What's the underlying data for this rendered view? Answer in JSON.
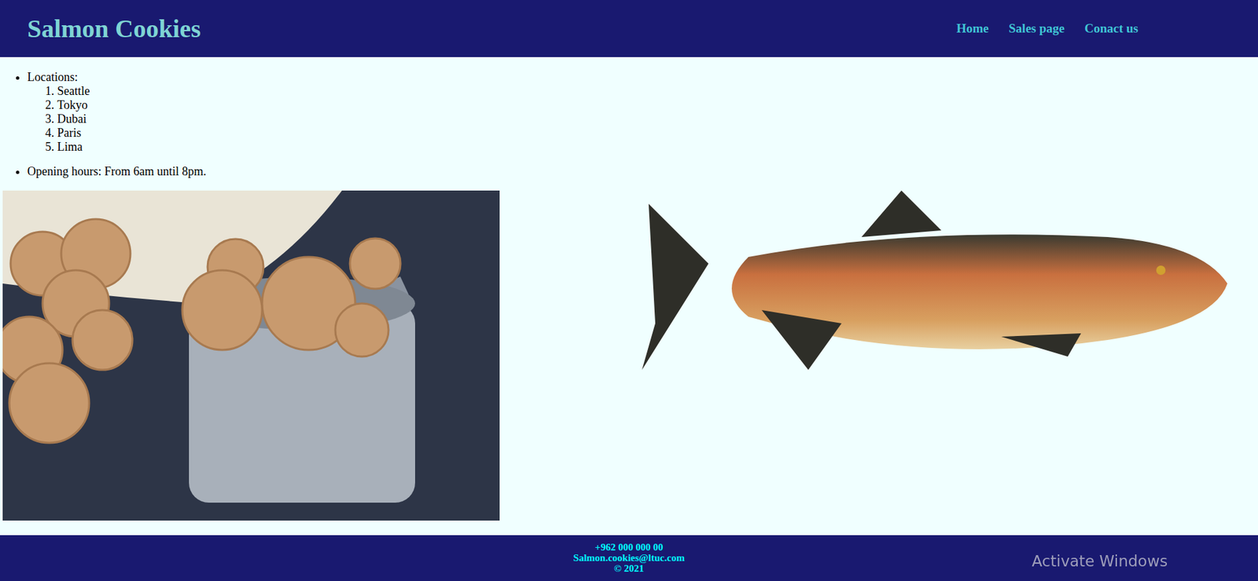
{
  "header": {
    "title": "Salmon Cookies",
    "nav": [
      {
        "label": "Home"
      },
      {
        "label": "Sales page"
      },
      {
        "label": "Conact us"
      }
    ]
  },
  "info": {
    "locations_label": "Locations:",
    "locations": [
      "Seattle",
      "Tokyo",
      "Dubai",
      "Paris",
      "Lima"
    ],
    "hours": "Opening hours: From 6am until 8pm."
  },
  "footer": {
    "lines": [
      "+962 000 000 00",
      "Salmon.cookies@ltuc.com",
      "© 2021"
    ]
  },
  "watermark": {
    "text": "Activate Windows"
  }
}
